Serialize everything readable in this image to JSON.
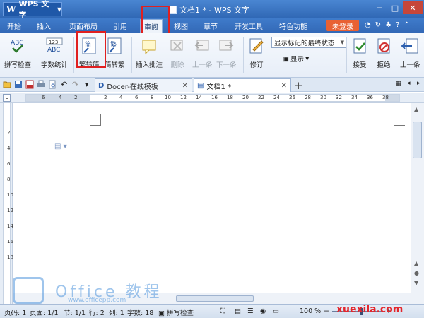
{
  "titlebar": {
    "app_name": "WPS 文字",
    "doc_title": "文档1 * - WPS 文字"
  },
  "menu": {
    "tabs": [
      "开始",
      "插入",
      "页面布局",
      "引用",
      "审阅",
      "视图",
      "章节",
      "开发工具",
      "特色功能"
    ],
    "active": "审阅",
    "login": "未登录"
  },
  "ribbon": {
    "spell_check": "拼写检查",
    "word_count": "字数统计",
    "trad_to_simp": "繁转简",
    "simp_to_trad": "简转繁",
    "insert_comment": "插入批注",
    "delete": "删除",
    "prev": "上一条",
    "next": "下一条",
    "track_changes": "修订",
    "display_status": "显示标记的最终状态",
    "show": "显示",
    "accept": "接受",
    "reject": "拒绝",
    "prev_change": "上一条",
    "icon_abc_label": "ABC",
    "icon_123_label": "123",
    "icon_jian_char": "简",
    "icon_fan_char": "繁"
  },
  "doc_tabs": {
    "template_tab": "Docer-在线模板",
    "doc_tab": "文档1 *"
  },
  "ruler": {
    "labels": [
      "6",
      "4",
      "2",
      "2",
      "4",
      "6",
      "8",
      "10",
      "12",
      "14",
      "16",
      "18",
      "20",
      "22",
      "24",
      "26",
      "28",
      "30",
      "32",
      "34",
      "36",
      "38"
    ],
    "vlabels": [
      "2",
      "4",
      "6",
      "8",
      "10",
      "12",
      "14",
      "16",
      "18"
    ],
    "corner": "L"
  },
  "status": {
    "page_code": "页码: 1",
    "page": "页面: 1/1",
    "section": "节: 1/1",
    "row": "行: 2",
    "col": "列: 1",
    "chars": "字数: 18",
    "spell": "拼写检查",
    "zoom": "100 %"
  },
  "watermarks": {
    "office": "Office 教程",
    "site": "www.officepp.com",
    "xuexila": "xuexila.com"
  },
  "colors": {
    "title_blue": "#2f67b4",
    "login_orange": "#e86133",
    "highlight_red": "#e02020"
  }
}
